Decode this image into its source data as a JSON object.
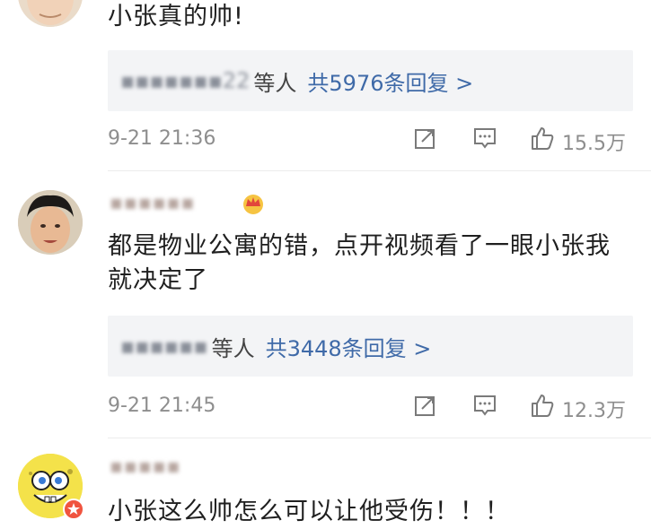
{
  "comments": [
    {
      "text": "小张真的帅!",
      "reply_names": "▪▪▪▪▪▪▪22",
      "reply_etc": "等人",
      "reply_count": "共5976条回复 >",
      "time": "9-21 21:36",
      "likes": "15.5万"
    },
    {
      "username": "▪▪▪▪▪▪",
      "text": "都是物业公寓的错，点开视频看了一眼小张我就决定了",
      "reply_names": "▪▪▪▪▪▪",
      "reply_etc": "等人",
      "reply_count": "共3448条回复 >",
      "time": "9-21 21:45",
      "likes": "12.3万"
    },
    {
      "username": "▪▪▪▪▪",
      "text": "小张这么帅怎么可以让他受伤！！！"
    }
  ],
  "colors": {
    "link": "#3f6aa8",
    "text": "#1f1f1f",
    "meta": "#8e8e8e",
    "reply_bg": "#f3f4f6"
  },
  "icons": [
    "forward-icon",
    "comment-icon",
    "like-icon",
    "crown-badge-icon",
    "verified-badge-icon"
  ]
}
